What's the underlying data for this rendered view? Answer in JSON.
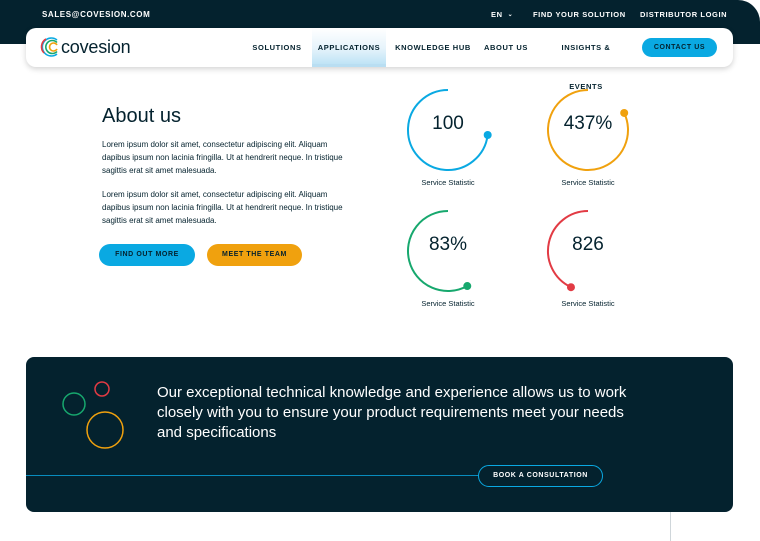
{
  "topbar": {
    "email": "SALES@COVESION.COM",
    "lang": "EN",
    "find_solution": "FIND YOUR SOLUTION",
    "distributor_login": "DISTRIBUTOR LOGIN"
  },
  "nav": {
    "logo_text": "covesion",
    "items": [
      {
        "label": "SOLUTIONS"
      },
      {
        "label": "APPLICATIONS"
      },
      {
        "label": "KNOWLEDGE HUB"
      },
      {
        "label": "ABOUT US"
      },
      {
        "label": "INSIGHTS & EVENTS"
      }
    ],
    "active_item": "APPLICATIONS",
    "contact_label": "CONTACT US"
  },
  "about": {
    "title": "About us",
    "para1": "Lorem ipsum dolor sit amet, consectetur adipiscing elit. Aliquam dapibus ipsum non lacinia fringilla. Ut at hendrerit neque. In tristique sagittis erat sit amet malesuada.",
    "para2": "Lorem ipsum dolor sit amet, consectetur adipiscing elit. Aliquam dapibus ipsum non lacinia fringilla. Ut at hendrerit neque. In tristique sagittis erat sit amet malesuada.",
    "btn_find": "FIND OUT MORE",
    "btn_team": "MEET THE TEAM"
  },
  "stats": [
    {
      "value": "100",
      "label": "Service Statistic",
      "color": "#0aa9e2",
      "arc_fraction": 0.73
    },
    {
      "value": "437%",
      "label": "Service Statistic",
      "color": "#f0a10e",
      "arc_fraction": 0.82
    },
    {
      "value": "83%",
      "label": "Service Statistic",
      "color": "#17a86e",
      "arc_fraction": 0.58
    },
    {
      "value": "826",
      "label": "Service Statistic",
      "color": "#e23b44",
      "arc_fraction": 0.43
    }
  ],
  "banner": {
    "text": "Our exceptional technical knowledge and experience allows us to work closely with you to ensure your product requirements meet your needs and specifications",
    "book_label": "BOOK A CONSULTATION"
  },
  "colors": {
    "dark": "#04222e",
    "accent_blue": "#0aa9e2",
    "accent_orange": "#f0a10e",
    "accent_green": "#17a86e",
    "accent_red": "#e23b44"
  }
}
